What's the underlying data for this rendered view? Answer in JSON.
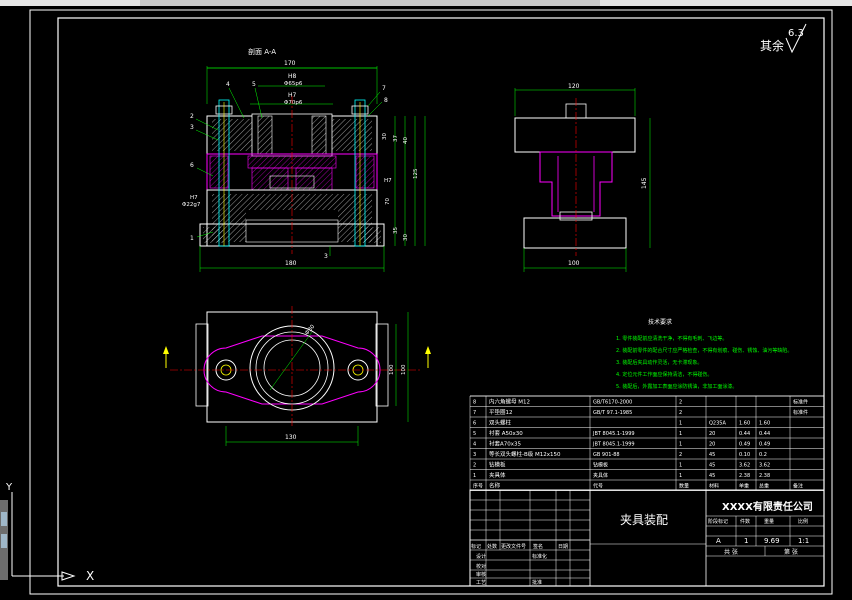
{
  "drawing": {
    "section_title": "剖面 A-A",
    "roughness_prefix": "其余",
    "roughness_value": "6.3",
    "front_dims": {
      "width_top": "170",
      "bore1": "H8",
      "bore1_fit": "Φ65p6",
      "bore2": "H7",
      "bore2_fit": "Φ70p6",
      "width_bottom": "180",
      "side_fit": "H7",
      "side_fit2": "Φ22g7",
      "heights": [
        "30",
        "37",
        "40",
        "125",
        "70",
        "35",
        "30"
      ],
      "h_right_fit": "H7",
      "balloons_left": [
        "2",
        "3",
        "6",
        "1"
      ],
      "balloons_top": [
        "4",
        "5",
        "7",
        "8"
      ],
      "label_bottom": "3"
    },
    "side_dims": {
      "width_top": "120",
      "height": "145",
      "width_bottom": "100"
    },
    "plan_dims": {
      "width": "130",
      "height_a": "100",
      "height_b": "100",
      "diameter": "Φ30"
    }
  },
  "notes": {
    "title": "技术要求",
    "items": [
      "1. 零件装配前应清洗干净，不得有毛刺、飞边等。",
      "2. 装配前零件的配合尺寸应严格检查，不得有划痕、碰伤、锈蚀、油污等缺陷。",
      "3. 装配后夹具动作灵活，无卡滞现象。",
      "4. 定位元件工作面应保持清洁，不得碰伤。",
      "5. 装配后，外露加工表面应涂防锈油，非加工面涂漆。"
    ]
  },
  "bom": {
    "rows": [
      {
        "no": "8",
        "name": "内六角螺母 M12",
        "code": "GB/T6170-2000",
        "qty": "2",
        "mat": "",
        "w1": "",
        "w2": "",
        "note": "标准件"
      },
      {
        "no": "7",
        "name": "平垫圈12",
        "code": "GB/T 97.1-1985",
        "qty": "2",
        "mat": "",
        "w1": "",
        "w2": "",
        "note": "标准件"
      },
      {
        "no": "6",
        "name": "双头螺柱",
        "code": "",
        "qty": "1",
        "mat": "Q235A",
        "w1": "1.60",
        "w2": "1.60",
        "note": ""
      },
      {
        "no": "5",
        "name": "衬套 A50x30",
        "code": "JBT 8045.1-1999",
        "qty": "1",
        "mat": "20",
        "w1": "0.44",
        "w2": "0.44",
        "note": ""
      },
      {
        "no": "4",
        "name": "衬套A70x35",
        "code": "JBT 8045.1-1999",
        "qty": "1",
        "mat": "20",
        "w1": "0.49",
        "w2": "0.49",
        "note": ""
      },
      {
        "no": "3",
        "name": "等长双头螺柱-B级 M12x150",
        "code": "GB 901-88",
        "qty": "2",
        "mat": "45",
        "w1": "0.10",
        "w2": "0.2",
        "note": ""
      },
      {
        "no": "2",
        "name": "钻模板",
        "code": "钻模板",
        "qty": "1",
        "mat": "45",
        "w1": "3.62",
        "w2": "3.62",
        "note": ""
      },
      {
        "no": "1",
        "name": "夹具体",
        "code": "夹具体",
        "qty": "1",
        "mat": "45",
        "w1": "2.38",
        "w2": "2.38",
        "note": ""
      }
    ],
    "header": {
      "no": "序号",
      "name": "名称",
      "code": "代号",
      "qty": "数量",
      "mat": "材料",
      "w1": "单重",
      "w2": "总重",
      "note": "备注"
    }
  },
  "title_block": {
    "drawing_title": "夹具装配",
    "company": "XXXX有限责任公司",
    "col_headers": [
      "阶段标记",
      "件数",
      "重量",
      "比例"
    ],
    "values": [
      "A",
      "1",
      "9.69",
      "1:1"
    ],
    "sheet_total": "共 张",
    "sheet_no": "第 张",
    "rev_headers": [
      "标记",
      "处数",
      "更改文件号",
      "签名",
      "日期"
    ],
    "roles": [
      "设计",
      "校对",
      "审核",
      "工艺"
    ],
    "role_right": [
      "标准化",
      "批准"
    ]
  },
  "ucs": {
    "y": "Y",
    "x": "X"
  },
  "colors": {
    "background": "#000000",
    "white": "#ffffff",
    "magenta": "#ff00ff",
    "cyan": "#00ffff",
    "green": "#00ff00",
    "yellow": "#ffff00",
    "red": "#ff0000",
    "grey": "#c8c8c8"
  }
}
